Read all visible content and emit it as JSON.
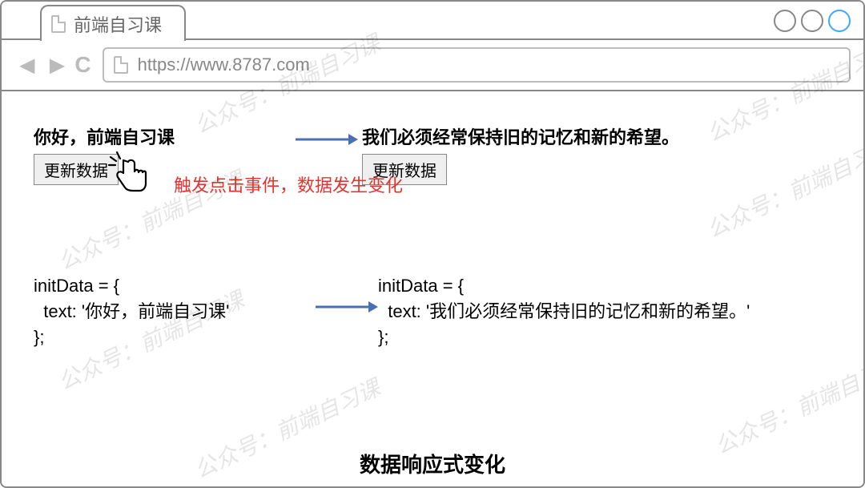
{
  "tab": {
    "title": "前端自习课"
  },
  "url": "https://www.8787.com",
  "content": {
    "left_headline": "你好，前端自习课",
    "right_headline": "我们必须经常保持旧的记忆和新的希望。",
    "button_label": "更新数据",
    "note": "触发点击事件，数据发生变化",
    "code_left_l1": "initData = {",
    "code_left_l2": "  text: '你好，前端自习课'",
    "code_left_l3": "};",
    "code_right_l1": "initData = {",
    "code_right_l2": "  text: '我们必须经常保持旧的记忆和新的希望。'",
    "code_right_l3": "};",
    "footer": "数据响应式变化"
  },
  "watermark": "公众号：前端自习课"
}
